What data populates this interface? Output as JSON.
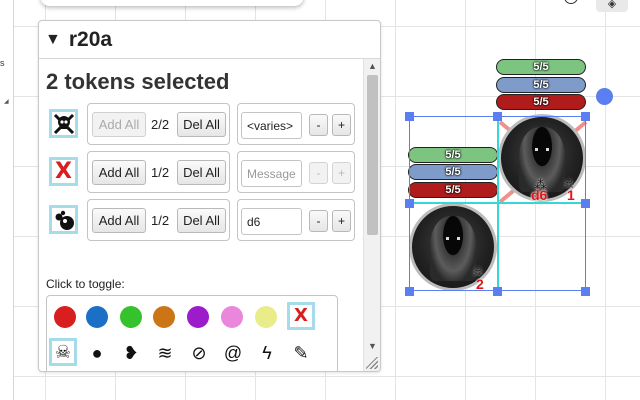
{
  "panel": {
    "title": "r20a",
    "heading": "2 tokens selected",
    "rows": [
      {
        "icon": "skull-crossbones-icon",
        "add": "Add All",
        "add_disabled": true,
        "count": "2/2",
        "del": "Del All",
        "field": "<varies>",
        "field_placeholder": false,
        "minus": "-",
        "plus": "+",
        "mini_disabled": false
      },
      {
        "icon": "red-x-icon",
        "add": "Add All",
        "add_disabled": false,
        "count": "1/2",
        "del": "Del All",
        "field": "Message",
        "field_placeholder": true,
        "minus": "-",
        "plus": "+",
        "mini_disabled": true
      },
      {
        "icon": "bubbles-icon",
        "add": "Add All",
        "add_disabled": false,
        "count": "1/2",
        "del": "Del All",
        "field": "d6",
        "field_placeholder": false,
        "minus": "-",
        "plus": "+",
        "mini_disabled": false
      }
    ],
    "toggle_label": "Click to toggle:"
  },
  "colors": {
    "swatches": [
      "#d81e1e",
      "#1c6fc7",
      "#36c22c",
      "#cc7516",
      "#9c1ccc",
      "#ea86dc",
      "#e9ec88"
    ],
    "selection": "#5b7ff0",
    "selected_outline": "#a6dbe9",
    "hp_green": "#7dc481",
    "hp_blue": "#7f9bc9",
    "hp_red": "#b01c1c"
  },
  "toggle_icons": {
    "row1_end": {
      "name": "red-x-icon",
      "glyph": "X",
      "selected": true
    },
    "row2": [
      {
        "name": "skull-crossbones-icon",
        "glyph": "☠",
        "selected": true
      },
      {
        "name": "mask-icon",
        "glyph": "●",
        "selected": false
      },
      {
        "name": "broken-heart-icon",
        "glyph": "❥",
        "selected": false
      },
      {
        "name": "flame-wisp-icon",
        "glyph": "≋",
        "selected": false
      },
      {
        "name": "prohibited-icon",
        "glyph": "⊘",
        "selected": false
      },
      {
        "name": "snail-icon",
        "glyph": "@",
        "selected": false
      },
      {
        "name": "lightning-icon",
        "glyph": "ϟ",
        "selected": false
      },
      {
        "name": "wrench-icon",
        "glyph": "✎",
        "selected": false
      }
    ],
    "row3": [
      {
        "name": "heart-icon",
        "glyph": "♥",
        "selected": false
      },
      {
        "name": "bubbles-icon",
        "glyph": "⁂",
        "selected": true
      },
      {
        "name": "fist-icon",
        "glyph": "✊",
        "selected": false
      },
      {
        "name": "boot-icon",
        "glyph": "⏏",
        "selected": false
      },
      {
        "name": "shatter-icon",
        "glyph": "✸",
        "selected": false
      },
      {
        "name": "hooded-icon",
        "glyph": "◓",
        "selected": false
      },
      {
        "name": "stopwatch-icon",
        "glyph": "⏱",
        "selected": false
      },
      {
        "name": "net-icon",
        "glyph": "⊞",
        "selected": false
      }
    ]
  },
  "tokens": {
    "token1": {
      "bars": [
        "5/5",
        "5/5",
        "5/5"
      ],
      "labels": [
        "d6",
        "1"
      ]
    },
    "token2": {
      "bars": [
        "5/5",
        "5/5",
        "5/5"
      ],
      "labels": [
        "2"
      ]
    }
  },
  "left_strip": {
    "text": "s"
  }
}
